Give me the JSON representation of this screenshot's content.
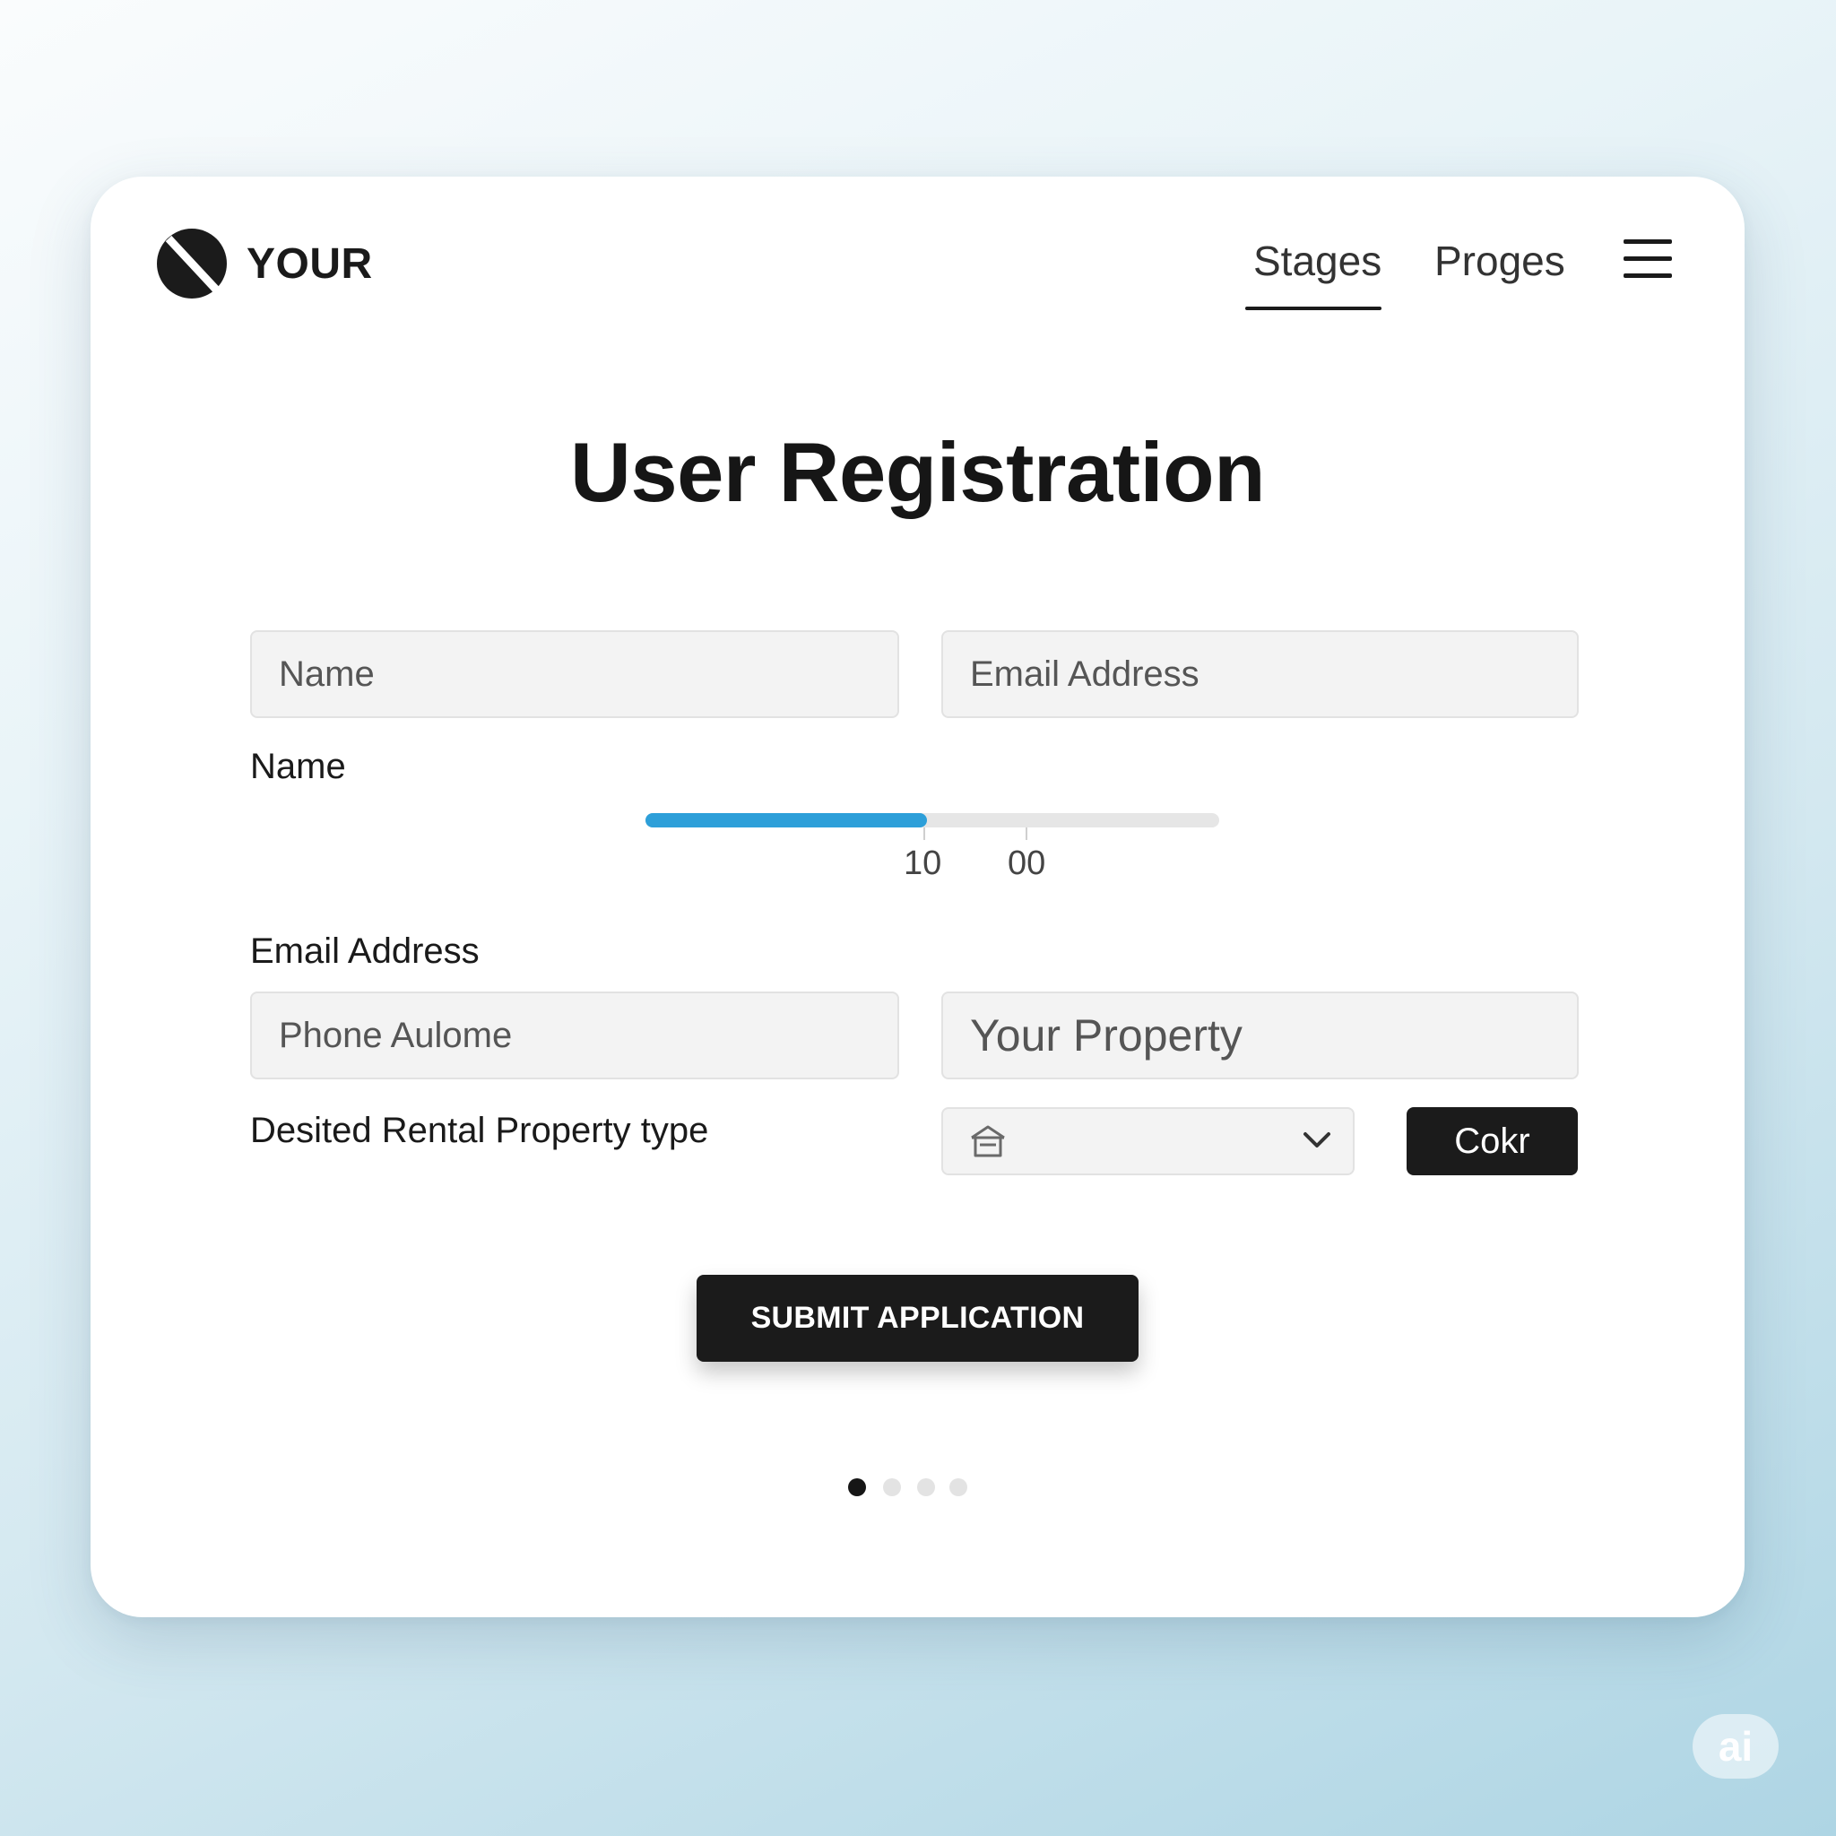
{
  "header": {
    "brand": "YOUR",
    "nav": [
      {
        "label": "Stages",
        "active": true
      },
      {
        "label": "Proges",
        "active": false
      }
    ],
    "menu_icon": "hamburger-menu-icon"
  },
  "form": {
    "title": "User Registration",
    "name_label": "Name",
    "name_placeholder": "Name",
    "email_placeholder": "Email Address",
    "slider": {
      "fill_fraction": 0.49,
      "tick_labels": [
        "10",
        "00"
      ],
      "color": "#2d9fd9"
    },
    "email_label": "Email Address",
    "phone_placeholder": "Phone Aulome",
    "property_placeholder": "Your Property",
    "rental_type_label": "Desited Rental Property type",
    "rental_type_select": {
      "icon": "house-icon",
      "selected_value": ""
    },
    "side_button_label": "Cokr",
    "submit_label": "SUBMIT APPLICATION"
  },
  "pagination": {
    "total": 4,
    "active_index": 0
  },
  "watermark": "ai",
  "colors": {
    "accent": "#2d9fd9",
    "button_dark": "#1b1b1b",
    "input_bg": "#f3f3f3"
  }
}
